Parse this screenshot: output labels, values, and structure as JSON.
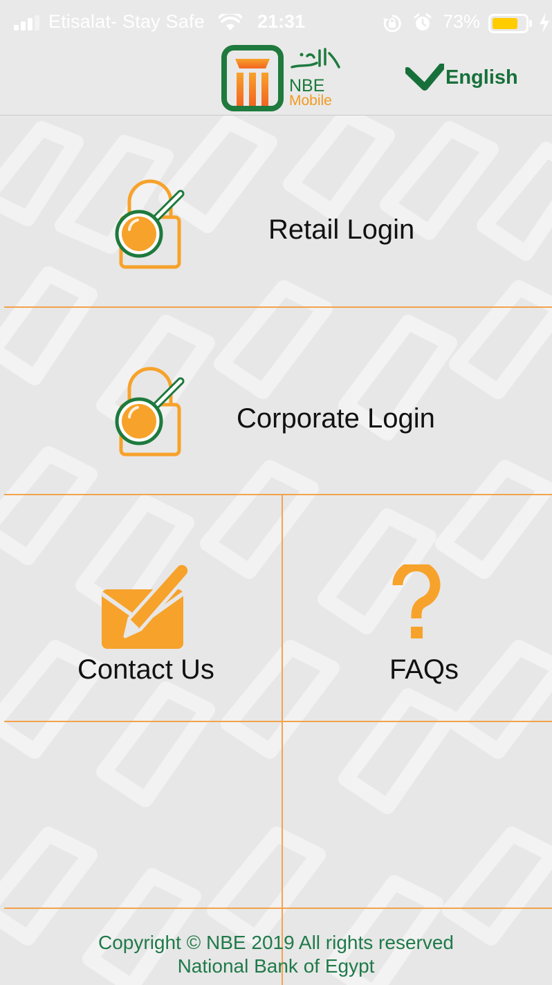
{
  "status_bar": {
    "carrier": "Etisalat- Stay Safe",
    "time": "21:31",
    "battery_percent": "73%",
    "icons": [
      "signal-icon",
      "wifi-icon",
      "rotation-lock-icon",
      "alarm-icon",
      "battery-icon",
      "charging-icon"
    ]
  },
  "header": {
    "logo_arabic": "الأهلي",
    "logo_nbe": "NBE",
    "logo_mobile": "Mobile",
    "language_label": "English"
  },
  "menu": {
    "retail_login_label": "Retail Login",
    "corporate_login_label": "Corporate Login",
    "contact_us_label": "Contact Us",
    "faqs_label": "FAQs",
    "faq_glyph": "?"
  },
  "footer": {
    "line1": "Copyright © NBE 2019 All rights reserved",
    "line2": "National Bank of Egypt"
  },
  "colors": {
    "accent_orange": "#f7a22b",
    "brand_green": "#17703a",
    "divider": "#f3a24c",
    "background": "#e7e7e7"
  }
}
